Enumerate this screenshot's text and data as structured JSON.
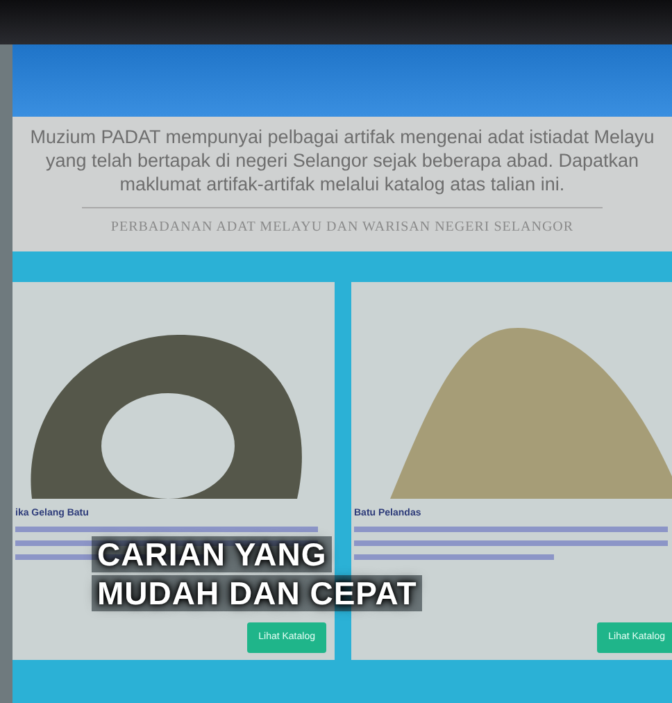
{
  "intro": {
    "text": "Muzium PADAT mempunyai pelbagai artifak mengenai adat istiadat Melayu yang telah bertapak di negeri Selangor sejak beberapa abad. Dapatkan maklumat artifak-artifak melalui katalog atas talian ini.",
    "subtitle": "PERBADANAN ADAT MELAYU DAN WARISAN NEGERI SELANGOR"
  },
  "cards": [
    {
      "title": "ika Gelang Batu",
      "button": "Lihat Katalog"
    },
    {
      "title": "Batu Pelandas",
      "button": "Lihat Katalog"
    }
  ],
  "overlay": {
    "lines": [
      "CARIAN YANG",
      "MUDAH DAN CEPAT"
    ]
  }
}
